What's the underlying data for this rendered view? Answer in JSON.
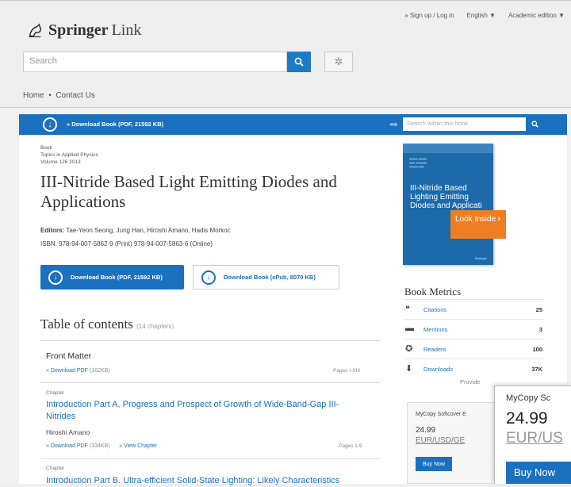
{
  "header": {
    "brand_bold": "Springer",
    "brand_light": "Link",
    "top_links": [
      "» Sign up / Log in",
      "English ▼",
      "Academic edition ▼"
    ],
    "search_placeholder": "Search",
    "breadcrumb": {
      "home": "Home",
      "sep": "•",
      "contact": "Contact Us"
    }
  },
  "toolbar": {
    "download_label": "» Download Book (PDF, 21592 KB)",
    "search_within_placeholder": "Search within this book"
  },
  "book": {
    "type": "Book",
    "series": "Topics in Applied Physics",
    "volume": "Volume 126 2013",
    "title": "III-Nitride Based Light Emitting Diodes and Applications",
    "editors_label": "Editors:",
    "editors": "Tae-Yeon Seong, Jung Han, Hiroshi Amano, Hadis Morkoc",
    "isbn": "ISBN: 978-94-007-5862-9 (Print) 978-94-007-5863-6 (Online)",
    "download_pdf": "Download Book (PDF, 21592 KB)",
    "download_epub": "Download Book (ePub, 8070 KB)"
  },
  "toc": {
    "heading": "Table of contents",
    "count": "(14 chapters)",
    "front_matter": {
      "title": "Front Matter",
      "download": "» Download PDF",
      "size": "(162KB)",
      "pages": "Pages I-XIII"
    },
    "chapters": [
      {
        "kind": "Chapter",
        "title": "Introduction Part A. Progress and Prospect of Growth of Wide-Band-Gap III-Nitrides",
        "author": "Hiroshi Amano",
        "download": "» Download PDF",
        "size": "(334KB)",
        "view": "» View Chapter",
        "pages": "Pages 1-9"
      },
      {
        "kind": "Chapter",
        "title": "Introduction Part B. Ultra-efficient Solid-State Lighting: Likely Characteristics"
      }
    ]
  },
  "cover": {
    "title": "III-Nitride Based Lighting Emitting Diodes and Applicati",
    "look_inside": "Look Inside",
    "publisher": "Springer"
  },
  "metrics": {
    "heading": "Book Metrics",
    "items": [
      {
        "label": "Citations",
        "value": "25",
        "icon": "quote-icon"
      },
      {
        "label": "Mentions",
        "value": "3",
        "icon": "speech-bubble-icon"
      },
      {
        "label": "Readers",
        "value": "100",
        "icon": "readers-icon"
      },
      {
        "label": "Downloads",
        "value": "37K",
        "icon": "download-icon"
      }
    ],
    "provided_by": "Provide"
  },
  "mycopy_inline": {
    "title": "MyCopy Softcover E",
    "price": "24.99",
    "currency": "EUR/USD/GE",
    "buy": "Buy Now"
  },
  "mycopy_popup": {
    "title": "MyCopy Sc",
    "price": "24.99",
    "currency": "EUR/US",
    "buy": "Buy Now"
  }
}
